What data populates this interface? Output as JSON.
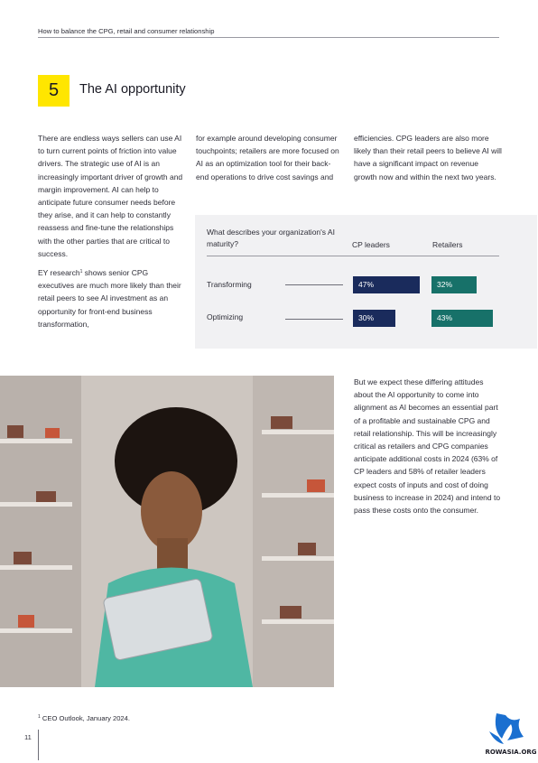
{
  "header": {
    "title": "How to balance the CPG, retail and consumer relationship"
  },
  "section": {
    "number": "5",
    "title": "The AI opportunity"
  },
  "columns": {
    "c1": [
      "There are endless ways sellers can use AI to turn current points of friction into value drivers. The strategic use of AI is an increasingly important driver of growth and margin improvement. AI can help to anticipate future consumer needs before they arise, and it can help to constantly reassess and fine-tune the relationships with the other parties that are critical to success.",
      "EY research",
      "1",
      " shows senior CPG executives are much more likely than their retail peers to see AI investment as an opportunity for front-end business transformation,"
    ],
    "c2": "for example around developing consumer touchpoints; retailers are more focused on AI as an optimization tool for their back-end operations to drive cost savings and",
    "c3": "efficiencies. CPG leaders are also more likely than their retail peers to believe AI will have a significant impact on revenue growth now and within the next two years.",
    "c4": "But we expect these differing attitudes about the AI opportunity to come into alignment as AI becomes an essential part of a profitable and sustainable CPG and retail relationship. This will be increasingly critical as retailers and CPG companies anticipate additional costs in 2024 (63% of CP leaders and 58% of retailer leaders expect costs of inputs and cost of doing business to increase in 2024) and intend to pass these costs onto the consumer."
  },
  "chart_data": {
    "type": "bar",
    "title": "What describes your organization's AI maturity?",
    "categories": [
      "Transforming",
      "Optimizing"
    ],
    "series": [
      {
        "name": "CP leaders",
        "values": [
          47,
          30
        ],
        "labels": [
          "47%",
          "30%"
        ],
        "color": "#1a2b5c"
      },
      {
        "name": "Retailers",
        "values": [
          32,
          43
        ],
        "labels": [
          "32%",
          "43%"
        ],
        "color": "#177169"
      }
    ],
    "unit": "%"
  },
  "footnote": {
    "mark": "1",
    "text": " CEO Outlook, January 2024."
  },
  "page": {
    "number": "11"
  },
  "watermark": {
    "text": "ROWASIA.ORG"
  },
  "colors": {
    "accent_yellow": "#ffe600",
    "navy": "#1a2b5c",
    "teal": "#177169"
  }
}
